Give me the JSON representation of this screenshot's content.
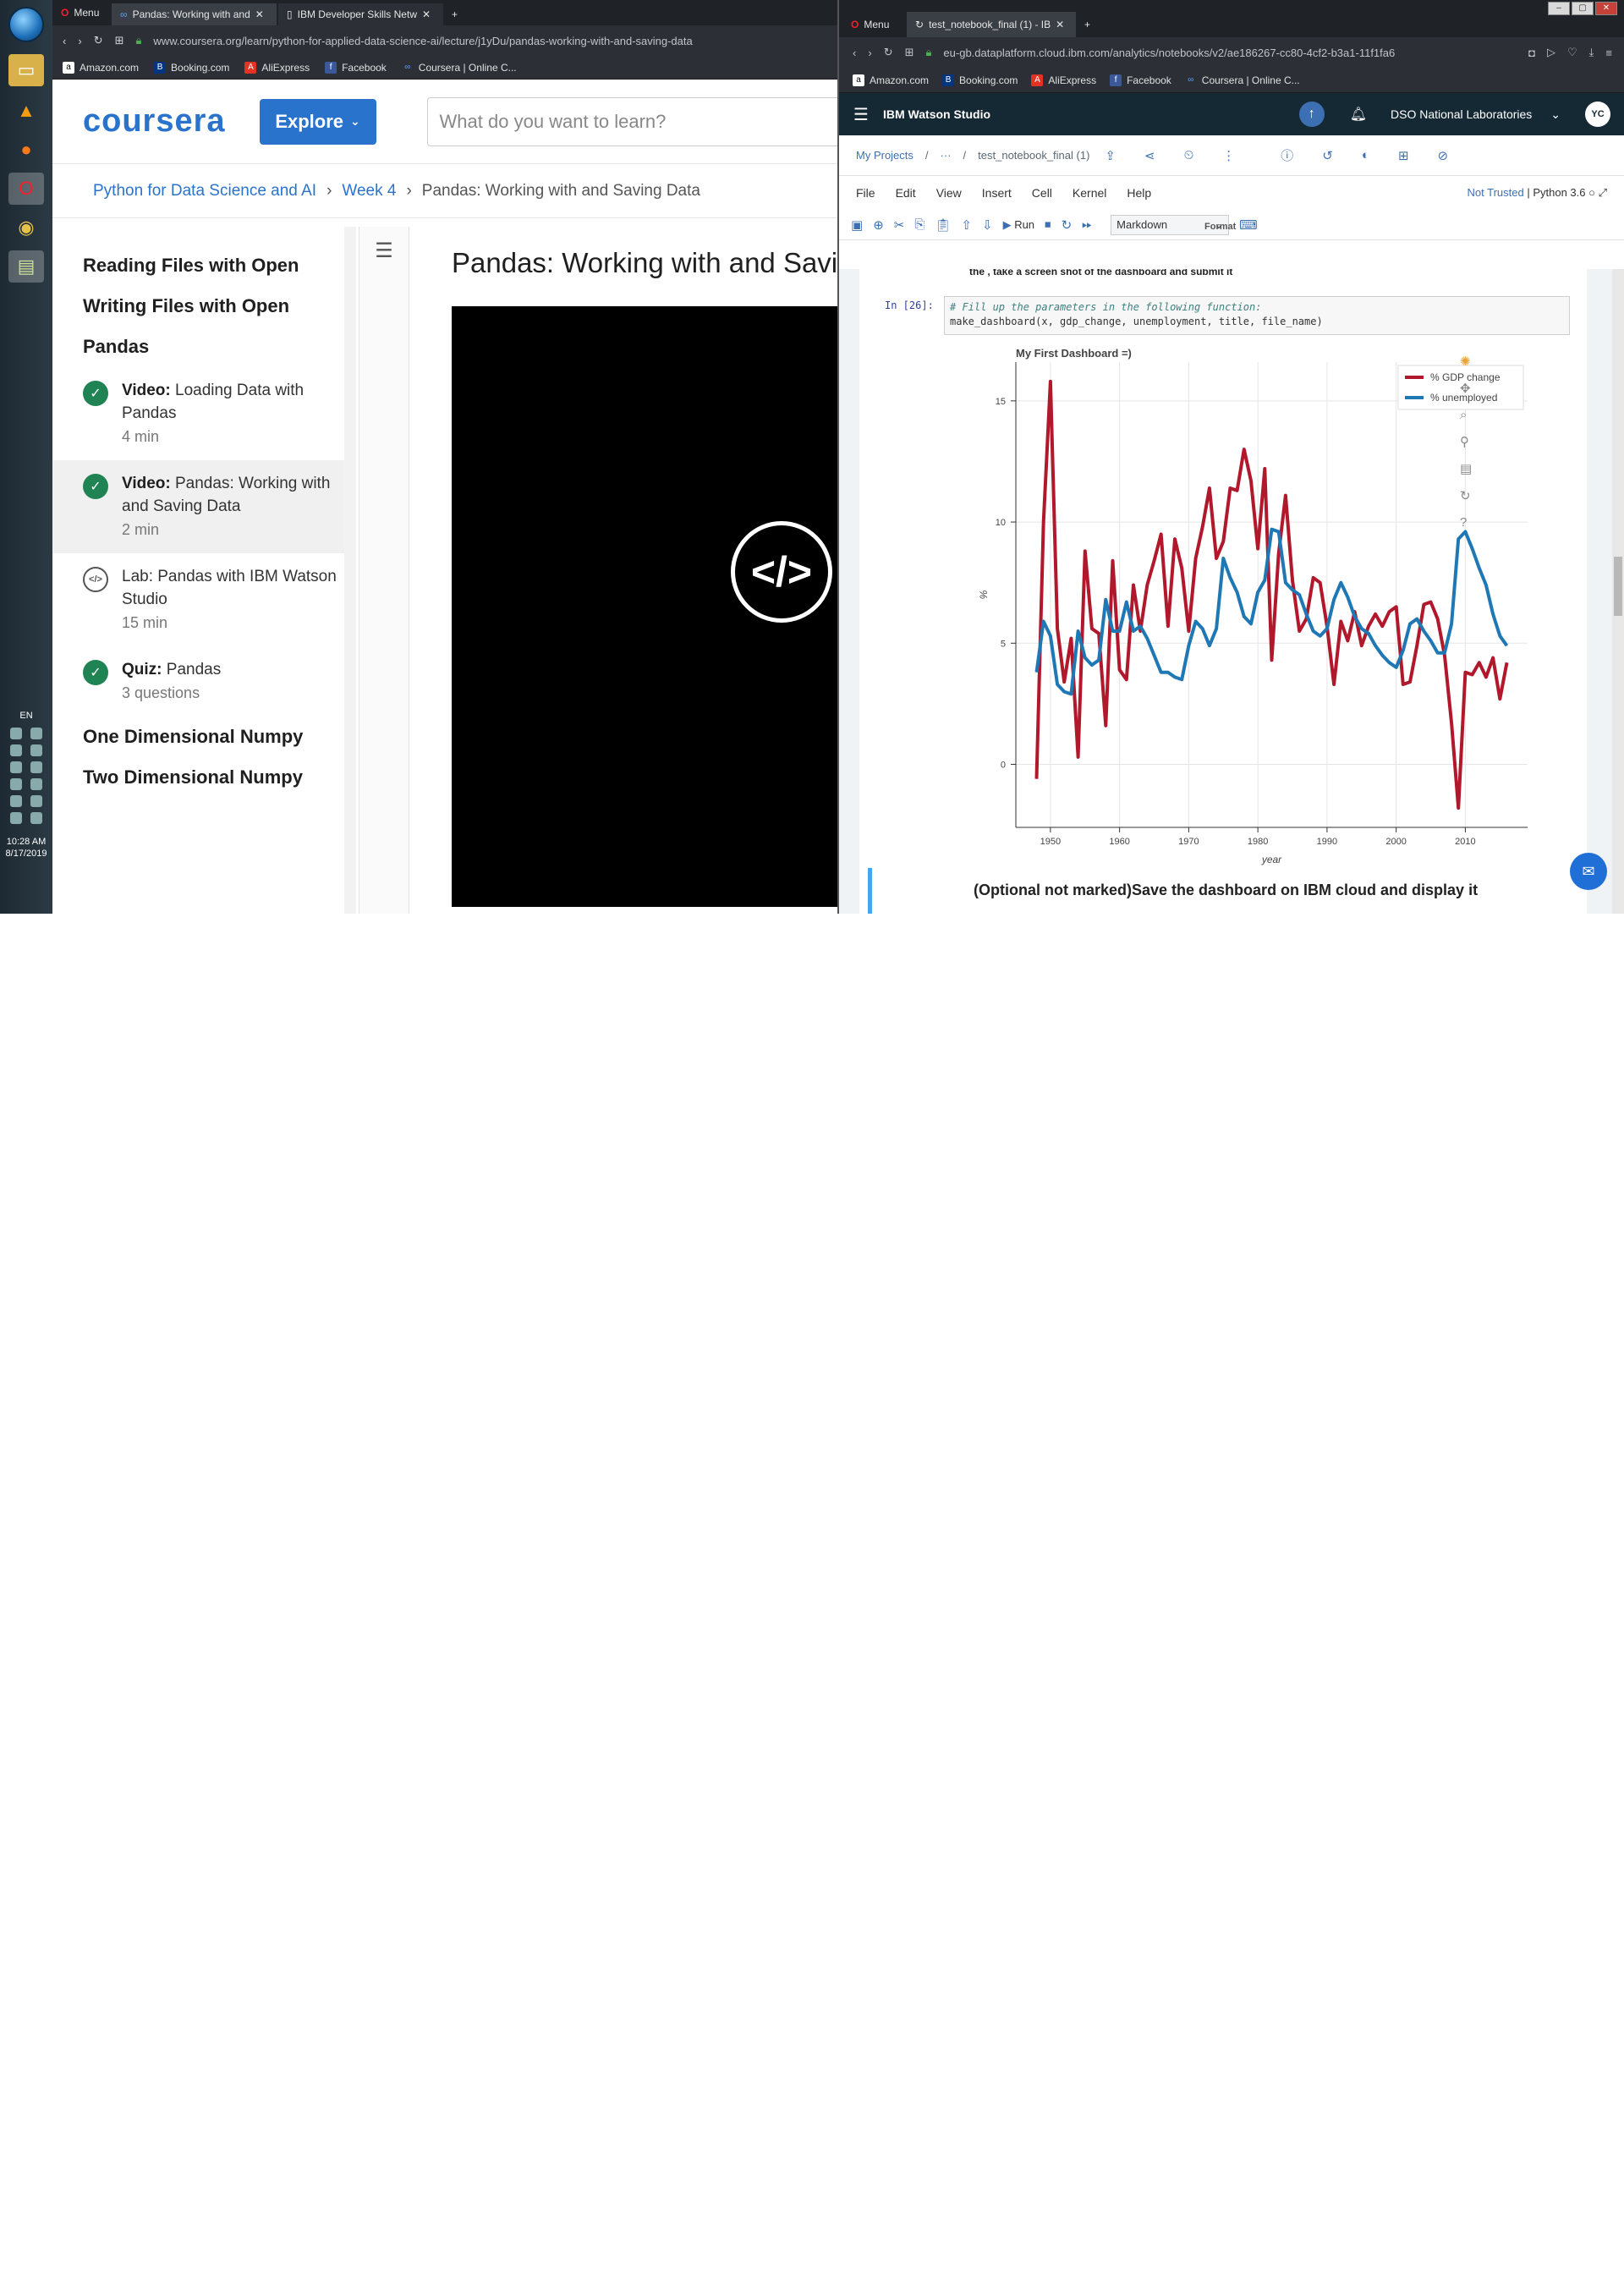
{
  "taskbar": {
    "language": "EN",
    "time": "10:28 AM",
    "date": "8/17/2019"
  },
  "left_browser": {
    "menu_label": "Menu",
    "tabs": [
      {
        "title": "Pandas: Working with and"
      },
      {
        "title": "IBM Developer Skills Netw"
      }
    ],
    "url": "www.coursera.org/learn/python-for-applied-data-science-ai/lecture/j1yDu/pandas-working-with-and-saving-data",
    "bookmarks": [
      "Amazon.com",
      "Booking.com",
      "AliExpress",
      "Facebook",
      "Coursera | Online C..."
    ]
  },
  "coursera": {
    "logo": "coursera",
    "explore_label": "Explore",
    "search_placeholder": "What do you want to learn?",
    "breadcrumbs": [
      "Python for Data Science and AI",
      "Week 4",
      "Pandas: Working with and Saving Data"
    ],
    "sidebar": {
      "head1": "Reading Files with Open",
      "head2": "Writing Files with Open",
      "head3": "Pandas",
      "items": [
        {
          "type_label": "Video:",
          "title": "Loading Data with Pandas",
          "duration": "4 min"
        },
        {
          "type_label": "Video:",
          "title": "Pandas: Working with and Saving Data",
          "duration": "2 min"
        },
        {
          "type_label": "",
          "title": "Lab: Pandas with IBM Watson Studio",
          "duration": "15 min"
        },
        {
          "type_label": "Quiz:",
          "title": "Pandas",
          "duration": "3 questions"
        }
      ],
      "head4": "One Dimensional Numpy",
      "head5": "Two Dimensional Numpy"
    },
    "video_title": "Pandas: Working with and Saving D"
  },
  "right_browser": {
    "menu_label": "Menu",
    "tab_title": "test_notebook_final (1) - IB",
    "url": "eu-gb.dataplatform.cloud.ibm.com/analytics/notebooks/v2/ae186267-cc80-4cf2-b3a1-11f1fa6",
    "bookmarks": [
      "Amazon.com",
      "Booking.com",
      "AliExpress",
      "Facebook",
      "Coursera | Online C..."
    ]
  },
  "watson": {
    "brand": "IBM Watson Studio",
    "org": "DSO National Laboratories",
    "avatar": "YC",
    "breadcrumb_projects": "My Projects",
    "breadcrumb_sep": "/",
    "breadcrumb_ellipsis": "···",
    "notebook_name": "test_notebook_final (1)",
    "menu": [
      "File",
      "Edit",
      "View",
      "Insert",
      "Cell",
      "Kernel",
      "Help"
    ],
    "trust": "Not Trusted",
    "kernel": "Python 3.6",
    "format_label": "Format",
    "run_label": "Run",
    "cell_type": "Markdown",
    "cut_text": "the , take a screen shot of the dashboard and submit it",
    "prompt": "In [26]:",
    "code_comment": "# Fill up the parameters in the following function:",
    "code_line": "make_dashboard(x, gdp_change, unemployment, title, file_name)",
    "md_cell_text": "(Optional not marked)Save the dashboard on IBM cloud and display it"
  },
  "chart_data": {
    "type": "line",
    "title": "My First Dashboard =)",
    "xlabel": "year",
    "ylabel": "%",
    "xlim": [
      1945,
      2019
    ],
    "ylim": [
      -2.6,
      16.6
    ],
    "xticks": [
      1950,
      1960,
      1970,
      1980,
      1990,
      2000,
      2010
    ],
    "yticks": [
      0,
      5,
      10,
      15
    ],
    "legend_position": "top-right",
    "x": [
      1948,
      1949,
      1950,
      1951,
      1952,
      1953,
      1954,
      1955,
      1956,
      1957,
      1958,
      1959,
      1960,
      1961,
      1962,
      1963,
      1964,
      1965,
      1966,
      1967,
      1968,
      1969,
      1970,
      1971,
      1972,
      1973,
      1974,
      1975,
      1976,
      1977,
      1978,
      1979,
      1980,
      1981,
      1982,
      1983,
      1984,
      1985,
      1986,
      1987,
      1988,
      1989,
      1990,
      1991,
      1992,
      1993,
      1994,
      1995,
      1996,
      1997,
      1998,
      1999,
      2000,
      2001,
      2002,
      2003,
      2004,
      2005,
      2006,
      2007,
      2008,
      2009,
      2010,
      2011,
      2012,
      2013,
      2014,
      2015,
      2016
    ],
    "series": [
      {
        "name": "% GDP change",
        "color": "#b2182b",
        "values": [
          -0.6,
          10.0,
          15.8,
          5.6,
          3.4,
          5.2,
          0.3,
          8.8,
          5.6,
          5.4,
          1.6,
          8.4,
          3.9,
          3.5,
          7.4,
          5.5,
          7.4,
          8.4,
          9.5,
          5.7,
          9.3,
          8.1,
          5.5,
          8.5,
          9.8,
          11.4,
          8.5,
          9.2,
          11.4,
          11.3,
          13.0,
          11.7,
          8.9,
          12.2,
          4.3,
          8.7,
          11.1,
          7.6,
          5.5,
          6.0,
          7.7,
          7.5,
          5.7,
          3.3,
          5.9,
          5.1,
          6.3,
          4.9,
          5.7,
          6.2,
          5.7,
          6.3,
          6.5,
          3.3,
          3.4,
          4.9,
          6.6,
          6.7,
          6.0,
          4.5,
          1.7,
          -1.8,
          3.8,
          3.7,
          4.2,
          3.6,
          4.4,
          2.7,
          4.2
        ]
      },
      {
        "name": "% unemployed",
        "color": "#1f78b4",
        "values": [
          3.8,
          5.9,
          5.3,
          3.3,
          3.0,
          2.9,
          5.5,
          4.4,
          4.1,
          4.3,
          6.8,
          5.5,
          5.5,
          6.7,
          5.5,
          5.7,
          5.2,
          4.5,
          3.8,
          3.8,
          3.6,
          3.5,
          4.9,
          5.9,
          5.6,
          4.9,
          5.6,
          8.5,
          7.7,
          7.1,
          6.1,
          5.8,
          7.1,
          7.6,
          9.7,
          9.6,
          7.5,
          7.2,
          7.0,
          6.2,
          5.5,
          5.3,
          5.6,
          6.8,
          7.5,
          6.9,
          6.1,
          5.6,
          5.4,
          4.9,
          4.5,
          4.2,
          4.0,
          4.7,
          5.8,
          6.0,
          5.5,
          5.1,
          4.6,
          4.6,
          5.8,
          9.3,
          9.6,
          8.9,
          8.1,
          7.4,
          6.2,
          5.3,
          4.9
        ]
      }
    ]
  }
}
